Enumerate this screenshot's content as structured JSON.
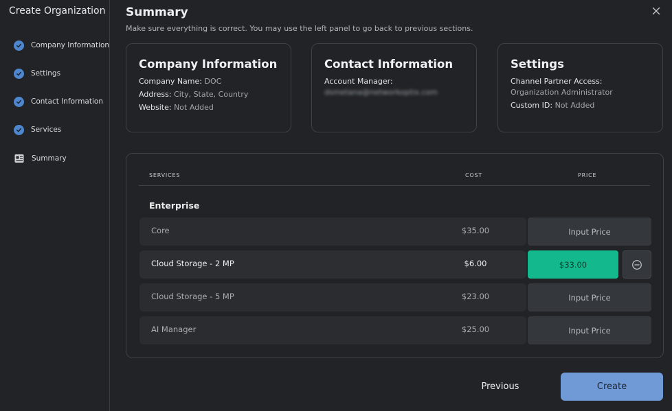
{
  "app": {
    "title": "Create Organization"
  },
  "sidebar": {
    "items": [
      {
        "label": "Company Information",
        "icon": "check-circle-icon",
        "completed": true
      },
      {
        "label": "Settings",
        "icon": "check-circle-icon",
        "completed": true
      },
      {
        "label": "Contact Information",
        "icon": "check-circle-icon",
        "completed": true
      },
      {
        "label": "Services",
        "icon": "check-circle-icon",
        "completed": true
      },
      {
        "label": "Summary",
        "icon": "summary-icon",
        "completed": false
      }
    ]
  },
  "header": {
    "title": "Summary",
    "subtitle": "Make sure everything is correct. You may use the left panel to go back to previous sections.",
    "close_icon": "close-icon"
  },
  "cards": {
    "company": {
      "title": "Company Information",
      "name_label": "Company Name:",
      "name_value": "DOC",
      "address_label": "Address:",
      "address_value": "City, State, Country",
      "website_label": "Website:",
      "website_value": "Not Added"
    },
    "contact": {
      "title": "Contact Information",
      "manager_label": "Account Manager:",
      "manager_value": "dsmetana@networkoptix.com"
    },
    "settings": {
      "title": "Settings",
      "partner_label": "Channel Partner Access:",
      "partner_value": "Organization Administrator",
      "custom_id_label": "Custom ID:",
      "custom_id_value": "Not Added"
    }
  },
  "services_table": {
    "columns": {
      "services": "SERVICES",
      "cost": "COST",
      "price": "PRICE"
    },
    "group": "Enterprise",
    "rows": [
      {
        "name": "Core",
        "cost": "$35.00",
        "price": "Input Price",
        "filled": false
      },
      {
        "name": "Cloud Storage - 2 MP",
        "cost": "$6.00",
        "price": "$33.00",
        "filled": true
      },
      {
        "name": "Cloud Storage - 5 MP",
        "cost": "$23.00",
        "price": "Input Price",
        "filled": false
      },
      {
        "name": "AI Manager",
        "cost": "$25.00",
        "price": "Input Price",
        "filled": false
      }
    ]
  },
  "footer": {
    "previous_label": "Previous",
    "create_label": "Create"
  },
  "colors": {
    "background": "#212326",
    "accent_blue": "#6f9ad6",
    "check_blue": "#4f87cf",
    "price_green": "#13b98c"
  }
}
